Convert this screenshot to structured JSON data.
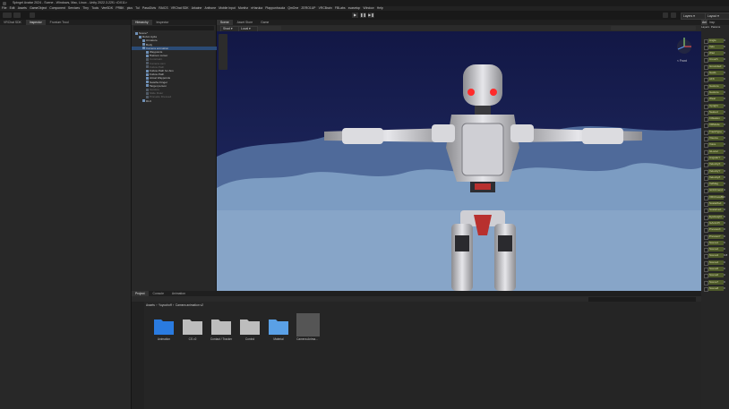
{
  "window": {
    "title": "Spingel Avatar 2024 - Scene - Windows, Mac, Linux - Unity 2022.3.22f1 <DX11>"
  },
  "menu": [
    "File",
    "Edit",
    "Assets",
    "GameObject",
    "Component",
    "Services",
    "Thry",
    "Tools",
    "VeeSDK",
    "PRBK",
    "plus",
    "Tul",
    "PasoDivis",
    "RAICS",
    "VRChat SDK",
    "Arkaine",
    "Anthone",
    "Mobile Input",
    "Monthz",
    "nHaruka",
    "Plappunhouda",
    "QmOne",
    "ZERO1UP",
    "VRCBrain",
    "FBLabs",
    "svasetop",
    "Window",
    "Help"
  ],
  "toolbar": {
    "layers_label": "Layers",
    "layout_label": "Layout"
  },
  "left_panel": {
    "tabs": [
      "VRChat SDK",
      "Inspector",
      "Fruntum Trool"
    ]
  },
  "hierarchy": {
    "tab": "Hierarchy",
    "tab2": "Inspector",
    "rows": [
      {
        "label": "Scene*",
        "dim": false,
        "sel": false,
        "indent": 0
      },
      {
        "label": "Robot Ayda",
        "dim": false,
        "sel": false,
        "indent": 1
      },
      {
        "label": "Armature",
        "dim": false,
        "sel": false,
        "indent": 2
      },
      {
        "label": "Body",
        "dim": false,
        "sel": false,
        "indent": 2
      },
      {
        "label": "Camera animation",
        "dim": false,
        "sel": true,
        "indent": 2
      },
      {
        "label": "Waypoints",
        "dim": false,
        "sel": false,
        "indent": 3
      },
      {
        "label": "Hairoon cursor",
        "dim": false,
        "sel": false,
        "indent": 3
      },
      {
        "label": "Constraint",
        "dim": true,
        "sel": false,
        "indent": 3
      },
      {
        "label": "Camera cam",
        "dim": true,
        "sel": false,
        "indent": 3
      },
      {
        "label": "Follow Path",
        "dim": true,
        "sel": false,
        "indent": 3
      },
      {
        "label": "Follow Path for Aim",
        "dim": false,
        "sel": false,
        "indent": 3
      },
      {
        "label": "Follow Path",
        "dim": false,
        "sel": false,
        "indent": 3
      },
      {
        "label": "Aimat Waypoints",
        "dim": false,
        "sel": false,
        "indent": 3
      },
      {
        "label": "Swathe Finger",
        "dim": false,
        "sel": false,
        "indent": 3
      },
      {
        "label": "Target person",
        "dim": false,
        "sel": false,
        "indent": 3
      },
      {
        "label": "Gesture",
        "dim": true,
        "sel": false,
        "indent": 3
      },
      {
        "label": "Slide Ruler",
        "dim": true,
        "sel": false,
        "indent": 3
      },
      {
        "label": "Pinnacle Dressed",
        "dim": true,
        "sel": false,
        "indent": 3
      },
      {
        "label": "DLC",
        "dim": false,
        "sel": false,
        "indent": 2
      }
    ]
  },
  "scene_view": {
    "tabs": [
      "Scene",
      "Asset Store",
      "Game"
    ],
    "shading": "Shad",
    "pivot": "Local",
    "gizmo_label": "< Front",
    "sky_color": "#161b4a",
    "cloud_color": "#7b9cc1"
  },
  "inspector": {
    "tabs": [
      "Ani",
      "Insp"
    ],
    "layers_tab": [
      "Layers",
      "Params"
    ],
    "params": [
      {
        "name": "Angle",
        "value": "0"
      },
      {
        "name": "Velo",
        "value": "0"
      },
      {
        "name": "Wiet",
        "value": "0"
      },
      {
        "name": "Crouch",
        "value": "0"
      },
      {
        "name": "Grounded",
        "value": "0"
      },
      {
        "name": "GestL",
        "value": "0"
      },
      {
        "name": "AFK",
        "value": "0"
      },
      {
        "name": "Gesture",
        "value": "0"
      },
      {
        "name": "Gesture",
        "value": "0"
      },
      {
        "name": "Wear",
        "value": "0"
      },
      {
        "name": "Upright",
        "value": "0"
      },
      {
        "name": "Seated",
        "value": "0"
      },
      {
        "name": "InStation",
        "value": "0"
      },
      {
        "name": "VRMode",
        "value": "0"
      },
      {
        "name": "TrackType",
        "value": "0"
      },
      {
        "name": "Viseme",
        "value": "0"
      },
      {
        "name": "Voice",
        "value": "0"
      },
      {
        "name": "IsLocal",
        "value": "0"
      },
      {
        "name": "AngularY",
        "value": "0"
      },
      {
        "name": "VelocityX",
        "value": "0"
      },
      {
        "name": "VelocityY",
        "value": "0"
      },
      {
        "name": "VelocityZ",
        "value": "0"
      },
      {
        "name": "VelMag",
        "value": "0"
      },
      {
        "name": "IsOnFriend",
        "value": "0"
      },
      {
        "name": "VRCFaceBlend",
        "value": "0"
      },
      {
        "name": "ScaleMod",
        "value": "0"
      },
      {
        "name": "ScaleFact",
        "value": "0"
      },
      {
        "name": "EyeHeight",
        "value": "0"
      },
      {
        "name": "IsAnimPl",
        "value": "0"
      },
      {
        "name": "PreviewX",
        "value": "0"
      },
      {
        "name": "PreviewY",
        "value": "0"
      },
      {
        "name": "Scene1",
        "value": "0"
      },
      {
        "name": "Scene2",
        "value": "0"
      },
      {
        "name": "Scene3",
        "value": "0.8"
      },
      {
        "name": "Scene4",
        "value": "0"
      },
      {
        "name": "Scene5",
        "value": "0"
      },
      {
        "name": "Scene6",
        "value": "0"
      },
      {
        "name": "Scene7",
        "value": "0"
      },
      {
        "name": "Scene8",
        "value": "0"
      }
    ]
  },
  "project": {
    "tabs": [
      "Project",
      "Console",
      "Animation"
    ],
    "breadcrumb": [
      "Assets",
      "Yuyoohoff",
      "Camera animation v2"
    ],
    "items": [
      {
        "name": "Animation",
        "kind": "folder-blue"
      },
      {
        "name": "CS v2",
        "kind": "folder"
      },
      {
        "name": "Contact / Tracker",
        "kind": "folder"
      },
      {
        "name": "Control",
        "kind": "folder"
      },
      {
        "name": "Material",
        "kind": "folder-light"
      },
      {
        "name": "Camera Anima...",
        "kind": "prefab"
      }
    ]
  }
}
